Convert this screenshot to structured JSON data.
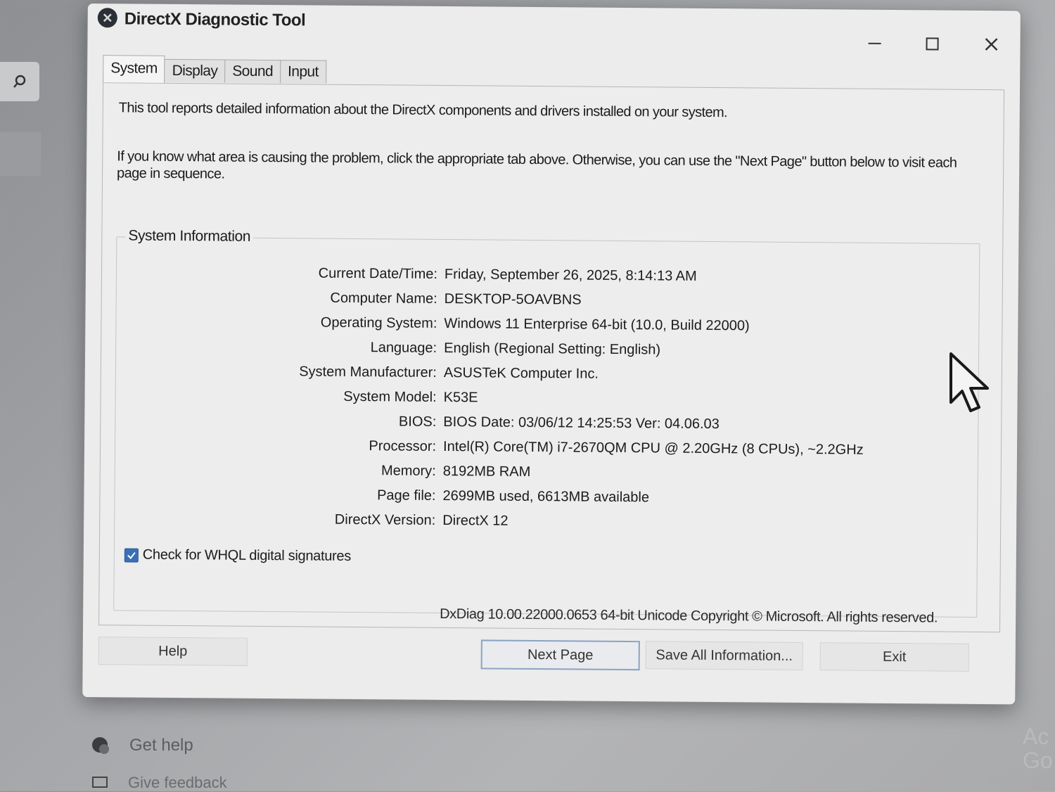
{
  "window": {
    "title": "DirectX Diagnostic Tool",
    "controls": {
      "minimize": "—",
      "maximize": "☐",
      "close": "✕"
    }
  },
  "tabs": [
    {
      "label": "System",
      "active": true
    },
    {
      "label": "Display",
      "active": false
    },
    {
      "label": "Sound",
      "active": false
    },
    {
      "label": "Input",
      "active": false
    }
  ],
  "intro": {
    "line1": "This tool reports detailed information about the DirectX components and drivers installed on your system.",
    "line2": "If you know what area is causing the problem, click the appropriate tab above.  Otherwise, you can use the \"Next Page\" button below to visit each page in sequence."
  },
  "system_info": {
    "title": "System Information",
    "rows": [
      {
        "label": "Current Date/Time:",
        "value": "Friday, September 26, 2025, 8:14:13 AM"
      },
      {
        "label": "Computer Name:",
        "value": "DESKTOP-5OAVBNS"
      },
      {
        "label": "Operating System:",
        "value": "Windows 11 Enterprise 64-bit (10.0, Build 22000)"
      },
      {
        "label": "Language:",
        "value": "English (Regional Setting: English)"
      },
      {
        "label": "System Manufacturer:",
        "value": "ASUSTeK Computer Inc."
      },
      {
        "label": "System Model:",
        "value": "K53E"
      },
      {
        "label": "BIOS:",
        "value": "BIOS Date: 03/06/12 14:25:53 Ver: 04.06.03"
      },
      {
        "label": "Processor:",
        "value": "Intel(R) Core(TM) i7-2670QM CPU @ 2.20GHz (8 CPUs), ~2.2GHz"
      },
      {
        "label": "Memory:",
        "value": "8192MB RAM"
      },
      {
        "label": "Page file:",
        "value": "2699MB used, 6613MB available"
      },
      {
        "label": "DirectX Version:",
        "value": "DirectX 12"
      }
    ]
  },
  "whql": {
    "label": "Check for WHQL digital signatures",
    "checked": true
  },
  "copyright": "DxDiag 10.00.22000.0653 64-bit Unicode  Copyright © Microsoft. All rights reserved.",
  "buttons": {
    "help": "Help",
    "next": "Next Page",
    "save": "Save All Information...",
    "exit": "Exit"
  },
  "background": {
    "get_help": "Get help",
    "give_feedback": "Give feedback",
    "activate": "Ac Go"
  },
  "colors": {
    "accent": "#3a6fb5",
    "window_bg": "#ececec"
  }
}
